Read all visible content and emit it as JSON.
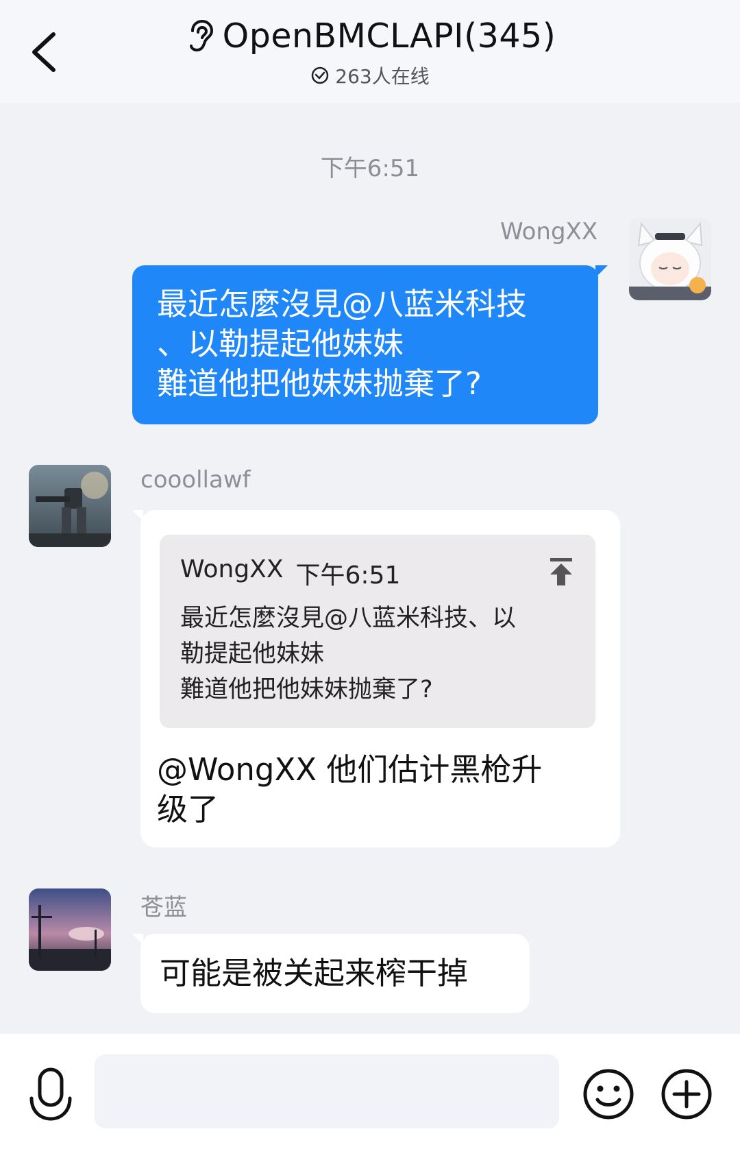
{
  "header": {
    "title": "OpenBMCLAPI(345)",
    "online_status": "263人在线"
  },
  "timestamp": "下午6:51",
  "messages": [
    {
      "sender": "WongXX",
      "lines": [
        "最近怎麼沒見@八蓝米科技",
        "、以勒提起他妹妹",
        "難道他把他妹妹抛棄了?"
      ]
    },
    {
      "sender": "cooollawf",
      "quote": {
        "author": "WongXX",
        "time": "下午6:51",
        "lines": [
          "最近怎麼沒見@八蓝米科技、以",
          "勒提起他妹妹",
          "難道他把他妹妹抛棄了?"
        ]
      },
      "lines": [
        "@WongXX 他们估计黑枪升",
        "级了"
      ]
    },
    {
      "sender": "苍蓝",
      "lines": [
        "可能是被关起来榨干掉"
      ]
    }
  ],
  "composer": {
    "placeholder": ""
  },
  "colors": {
    "accent": "#1f87f8",
    "background": "#f1f2f6",
    "bubble_other": "#ffffff",
    "quote_bg": "#eceaec"
  },
  "icons": [
    "back-arrow-icon",
    "ear-icon",
    "check-circle-icon",
    "jump-to-message-icon",
    "microphone-icon",
    "emoji-icon",
    "plus-circle-icon"
  ]
}
